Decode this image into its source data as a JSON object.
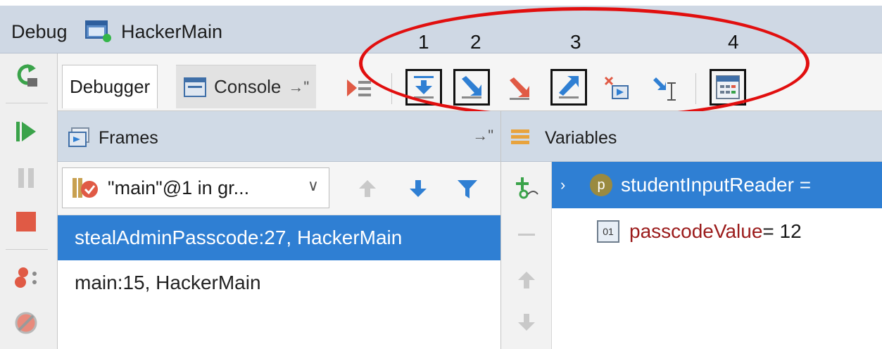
{
  "title": {
    "label": "Debug",
    "run_config": "HackerMain"
  },
  "tabs": {
    "debugger": "Debugger",
    "console": "Console"
  },
  "annotations": {
    "n1": "1",
    "n2": "2",
    "n3": "3",
    "n4": "4"
  },
  "frames": {
    "header": "Frames",
    "thread": "\"main\"@1 in gr...",
    "items": [
      {
        "label": "stealAdminPasscode:27, HackerMain",
        "selected": true
      },
      {
        "label": "main:15, HackerMain",
        "selected": false
      }
    ]
  },
  "variables": {
    "header": "Variables",
    "items": [
      {
        "badge": "p",
        "label": "studentInputReader = "
      },
      {
        "name": "passcodeValue",
        "value": " = 12"
      }
    ]
  },
  "colors": {
    "selection": "#2f7fd3",
    "annotation": "#e10f0f",
    "panel_header": "#d0dae6"
  }
}
